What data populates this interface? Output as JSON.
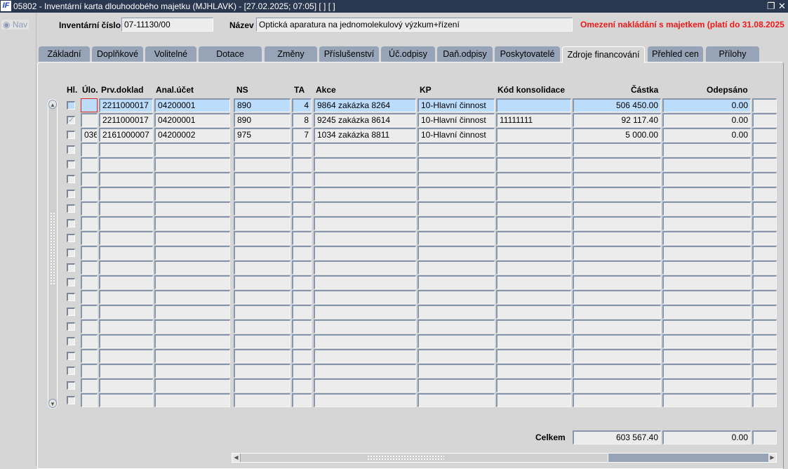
{
  "window": {
    "title": "05802 - Inventární karta dlouhodobého majetku (MJHLAVK) - [27.02.2025; 07:05]  [ ]  [ ]",
    "logo": "IF",
    "restore_icon": "❐",
    "close_icon": "✕"
  },
  "nav": {
    "label": "Nav"
  },
  "header": {
    "inv_label": "Inventární číslo",
    "inv_value": "07-11130/00",
    "name_label": "Název",
    "name_value": "Optická aparatura na jednomolekulový výzkum+řízení",
    "warning": "Omezení nakládání s majetkem (platí do 31.08.2025"
  },
  "tabs": [
    "Základní",
    "Doplňkové",
    "Volitelné",
    "Dotace",
    "Změny",
    "Příslušenství",
    "Úč.odpisy",
    "Daň.odpisy",
    "Poskytovatelé",
    "Zdroje financování",
    "Přehled cen",
    "Přílohy"
  ],
  "active_tab": "Zdroje financování",
  "table": {
    "headers": [
      "Hl.",
      "Úlo.",
      "Prv.doklad",
      "Anal.účet",
      "NS",
      "TA",
      "Akce",
      "KP",
      "Kód konsolidace",
      "Částka",
      "Odepsáno"
    ],
    "rows": [
      {
        "hl": false,
        "ulo": "",
        "prv": "2211000017",
        "anal": "04200001",
        "ns": "890",
        "ta": "4",
        "akce": "9864 zakázka 8264",
        "kp": "10-Hlavní činnost",
        "kod": "",
        "castka": "506 450.00",
        "odepsano": "0.00"
      },
      {
        "hl": true,
        "ulo": "",
        "prv": "2211000017",
        "anal": "04200001",
        "ns": "890",
        "ta": "8",
        "akce": "9245 zakázka 8614",
        "kp": "10-Hlavní činnost",
        "kod": "11111111",
        "castka": "92 117.40",
        "odepsano": "0.00"
      },
      {
        "hl": false,
        "ulo": "036",
        "prv": "2161000007",
        "anal": "04200002",
        "ns": "975",
        "ta": "7",
        "akce": "1034 zakázka 8811",
        "kp": "10-Hlavní činnost",
        "kod": "",
        "castka": "5 000.00",
        "odepsano": "0.00"
      }
    ],
    "empty_rows": 18
  },
  "totals": {
    "label": "Celkem",
    "castka": "603 567.40",
    "odepsano": "0.00"
  }
}
